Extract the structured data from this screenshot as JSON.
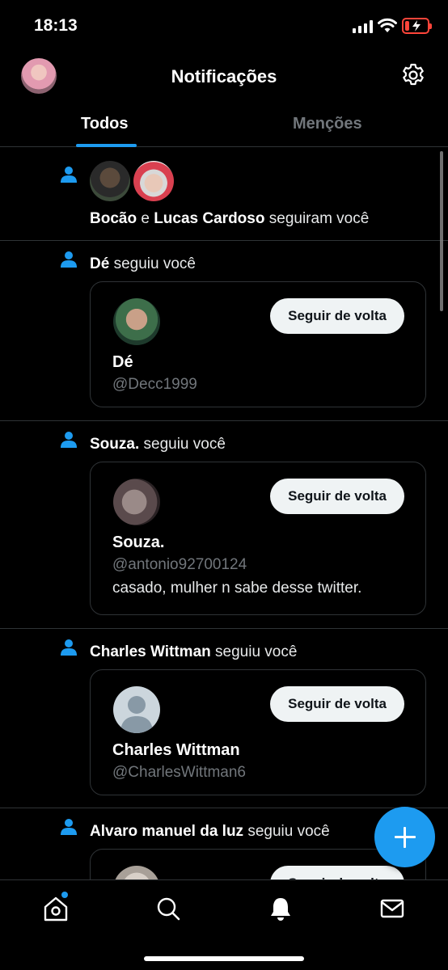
{
  "status_bar": {
    "time": "18:13"
  },
  "header": {
    "title": "Notificações"
  },
  "tabs": [
    {
      "label": "Todos",
      "active": true
    },
    {
      "label": "Menções",
      "active": false
    }
  ],
  "notifications": [
    {
      "type": "group_follow",
      "name1": "Bocão",
      "conj": " e ",
      "name2": "Lucas Cardoso",
      "action": " seguiram você"
    },
    {
      "type": "follow",
      "name": "Dé",
      "action": " seguiu você",
      "card": {
        "button": "Seguir de volta",
        "name": "Dé",
        "handle": "@Decc1999",
        "bio": ""
      }
    },
    {
      "type": "follow",
      "name": "Souza.",
      "action": " seguiu você",
      "card": {
        "button": "Seguir de volta",
        "name": "Souza.",
        "handle": "@antonio92700124",
        "bio": "casado, mulher n sabe desse twitter."
      }
    },
    {
      "type": "follow",
      "name": "Charles Wittman",
      "action": " seguiu você",
      "card": {
        "button": "Seguir de volta",
        "name": "Charles Wittman",
        "handle": "@CharlesWittman6",
        "bio": ""
      }
    },
    {
      "type": "follow",
      "name": "Alvaro manuel da luz",
      "action": " seguiu você",
      "card": {
        "button": "Seguir de volta"
      }
    }
  ],
  "icons": {
    "compose": "plus-icon",
    "nav": [
      "home-icon",
      "search-icon",
      "bell-icon",
      "mail-icon"
    ]
  },
  "colors": {
    "accent": "#1d9bf0",
    "background": "#000000",
    "battery_low": "#ff453a"
  }
}
